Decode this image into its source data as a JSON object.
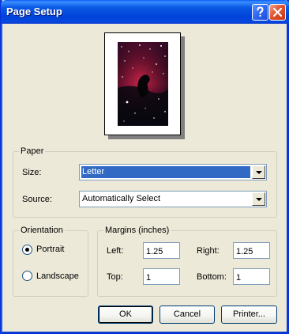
{
  "window": {
    "title": "Page Setup"
  },
  "titlebar": {
    "help_icon": "help-icon",
    "close_icon": "close-icon"
  },
  "preview": {
    "image_subject": "horsehead-nebula"
  },
  "paper": {
    "group_label": "Paper",
    "size_label": "Size:",
    "size_value": "Letter",
    "source_label": "Source:",
    "source_value": "Automatically Select"
  },
  "orientation": {
    "group_label": "Orientation",
    "options": [
      {
        "label": "Portrait",
        "checked": true
      },
      {
        "label": "Landscape",
        "checked": false
      }
    ]
  },
  "margins": {
    "group_label": "Margins (inches)",
    "left_label": "Left:",
    "left_value": "1.25",
    "right_label": "Right:",
    "right_value": "1.25",
    "top_label": "Top:",
    "top_value": "1",
    "bottom_label": "Bottom:",
    "bottom_value": "1"
  },
  "buttons": {
    "ok": "OK",
    "cancel": "Cancel",
    "printer": "Printer..."
  },
  "colors": {
    "title_bar": "#0a59f7",
    "dialog_bg": "#ece9d8",
    "selection": "#316ac5",
    "close_button": "#e0532f"
  }
}
